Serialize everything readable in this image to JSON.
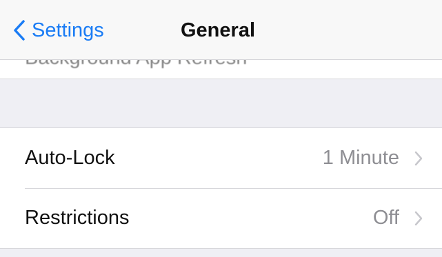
{
  "navbar": {
    "back_label": "Settings",
    "title": "General",
    "back_icon": "chevron-left-icon",
    "accent_color": "#1a7cf5"
  },
  "cutoff_row": {
    "label": "Background App Refresh"
  },
  "settings": {
    "rows": [
      {
        "label": "Auto-Lock",
        "value": "1 Minute",
        "icon": "chevron-right-icon"
      },
      {
        "label": "Restrictions",
        "value": "Off",
        "icon": "chevron-right-icon"
      }
    ]
  }
}
